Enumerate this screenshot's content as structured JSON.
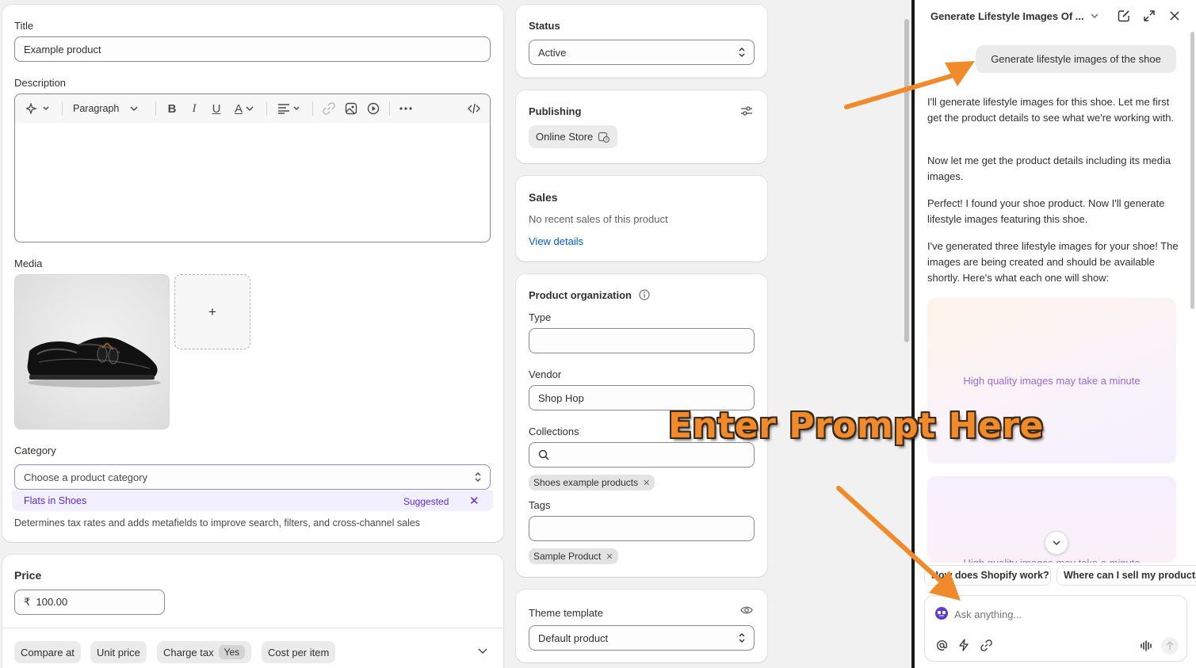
{
  "product": {
    "title_label": "Title",
    "title_value": "Example product",
    "description_label": "Description",
    "toolbar": {
      "paragraph": "Paragraph"
    },
    "media_label": "Media",
    "media_add": "+",
    "category_label": "Category",
    "category_placeholder": "Choose a product category",
    "category_suggestion": "Flats in Shoes",
    "suggested": "Suggested",
    "category_help": "Determines tax rates and adds metafields to improve search, filters, and cross-channel sales"
  },
  "price": {
    "label": "Price",
    "value": "₹  100.00",
    "tabs": [
      "Compare at",
      "Unit price",
      "Charge tax",
      "Cost per item"
    ],
    "charge_tax_badge": "Yes"
  },
  "status": {
    "label": "Status",
    "value": "Active"
  },
  "publishing": {
    "label": "Publishing",
    "channel": "Online Store"
  },
  "sales": {
    "label": "Sales",
    "text": "No recent sales of this product",
    "link": "View details"
  },
  "organization": {
    "label": "Product organization",
    "type_label": "Type",
    "type_value": "",
    "vendor_label": "Vendor",
    "vendor_value": "Shop Hop",
    "collections_label": "Collections",
    "collection_tag": "Shoes example products",
    "tags_label": "Tags",
    "tag": "Sample Product"
  },
  "theme": {
    "label": "Theme template",
    "value": "Default product"
  },
  "chat": {
    "title": "Generate Lifestyle Images Of ...",
    "user_message": "Generate lifestyle images of the shoe",
    "responses": [
      "I'll generate lifestyle images for this shoe. Let me first get the product details to see what we're working with.",
      "Now let me get the product details including its media images.",
      "Perfect! I found your shoe product. Now I'll generate lifestyle images featuring this shoe.",
      "I've generated three lifestyle images for your shoe! The images are being created and should be available shortly. Here's what each one will show:"
    ],
    "generating_text": "High quality images may take a minute",
    "suggestions": [
      "How does Shopify work?",
      "Where can I sell my products?"
    ],
    "input_placeholder": "Ask anything..."
  },
  "annotation": {
    "text": "Enter Prompt Here",
    "color": "#f08a2b"
  }
}
